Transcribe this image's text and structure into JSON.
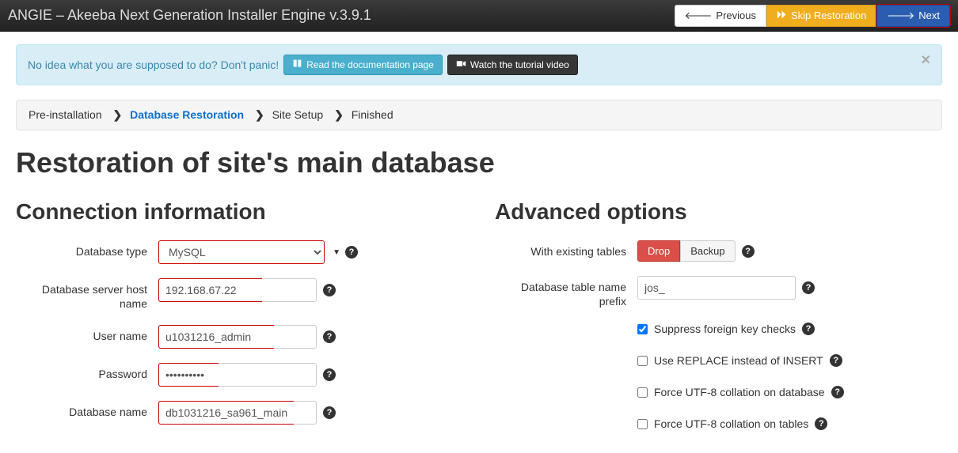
{
  "navbar": {
    "title": "ANGIE – Akeeba Next Generation Installer Engine v.3.9.1",
    "previous": "Previous",
    "skip": "Skip Restoration",
    "next": "Next"
  },
  "alert": {
    "text": "No idea what you are supposed to do? Don't panic!",
    "doc_btn": "Read the documentation page",
    "video_btn": "Watch the tutorial video"
  },
  "breadcrumb": {
    "step1": "Pre-installation",
    "step2": "Database Restoration",
    "step3": "Site Setup",
    "step4": "Finished"
  },
  "page_title": "Restoration of site's main database",
  "connection": {
    "heading": "Connection information",
    "db_type_label": "Database type",
    "db_type_value": "MySQL",
    "host_label": "Database server host name",
    "host_value": "192.168.67.22",
    "user_label": "User name",
    "user_value": "u1031216_admin",
    "pass_label": "Password",
    "pass_value": "••••••••••",
    "dbname_label": "Database name",
    "dbname_value": "db1031216_sa961_main"
  },
  "advanced": {
    "heading": "Advanced options",
    "existing_label": "With existing tables",
    "drop": "Drop",
    "backup": "Backup",
    "prefix_label": "Database table name prefix",
    "prefix_value": "jos_",
    "suppress_fk": "Suppress foreign key checks",
    "use_replace": "Use REPLACE instead of INSERT",
    "force_utf8_db": "Force UTF-8 collation on database",
    "force_utf8_tables": "Force UTF-8 collation on tables"
  }
}
